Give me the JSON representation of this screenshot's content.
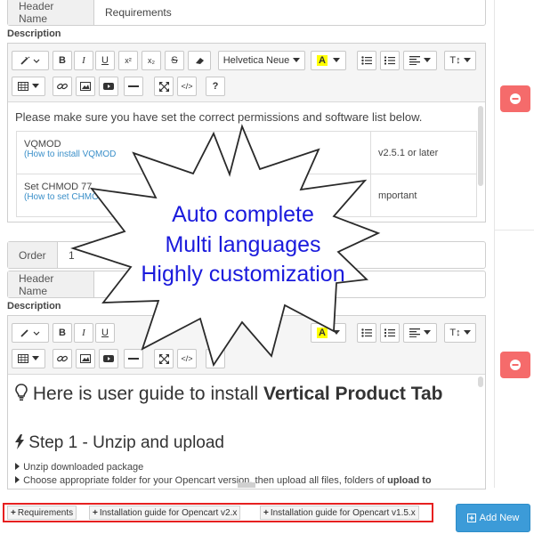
{
  "block1": {
    "header_label": "Header Name",
    "header_value": "Requirements",
    "description_label": "Description",
    "intro_text": "Please make sure you have set the correct permissions and software list below.",
    "rows": [
      {
        "name": "VQMOD",
        "link": "(How to install VQMOD",
        "value": "v2.5.1 or later"
      },
      {
        "name": "Set CHMOD 77",
        "link": "(How to set CHMOD",
        "value": "mportant"
      }
    ]
  },
  "toolbar": {
    "font_name": "Helvetica Neue",
    "highlight_letter": "A",
    "help_label": "?",
    "bold": "B",
    "italic": "I",
    "underline": "U",
    "superscript": "x²",
    "subscript": "x₂",
    "strike": "S",
    "textsize": "T↕",
    "code": "</>"
  },
  "block2": {
    "order_label": "Order",
    "order_value": "1",
    "header_label": "Header Name",
    "description_label": "Description",
    "heading_plain": "Here is user guide to install ",
    "heading_bold": "Vertical Product Tab",
    "step_title": "Step 1 - Unzip and upload",
    "bullet1": "Unzip downloaded package",
    "bullet2_plain": "Choose appropriate folder for your Opencart version, then upload all files, folders of ",
    "bullet2_bold": "upload to"
  },
  "burst": {
    "line1": "Auto complete",
    "line2": "Multi languages",
    "line3": "Highly customization"
  },
  "tabs": [
    {
      "label": "Requirements"
    },
    {
      "label": "Installation guide for Opencart v2.x"
    },
    {
      "label": "Installation guide for Opencart v1.5.x"
    }
  ],
  "add_new_label": "Add New",
  "colors": {
    "delete": "#f56b6b",
    "add_new": "#3c9bd8",
    "highlight_border": "#e62020",
    "burst_text": "#1a1adc",
    "link": "#3a8fc9"
  }
}
